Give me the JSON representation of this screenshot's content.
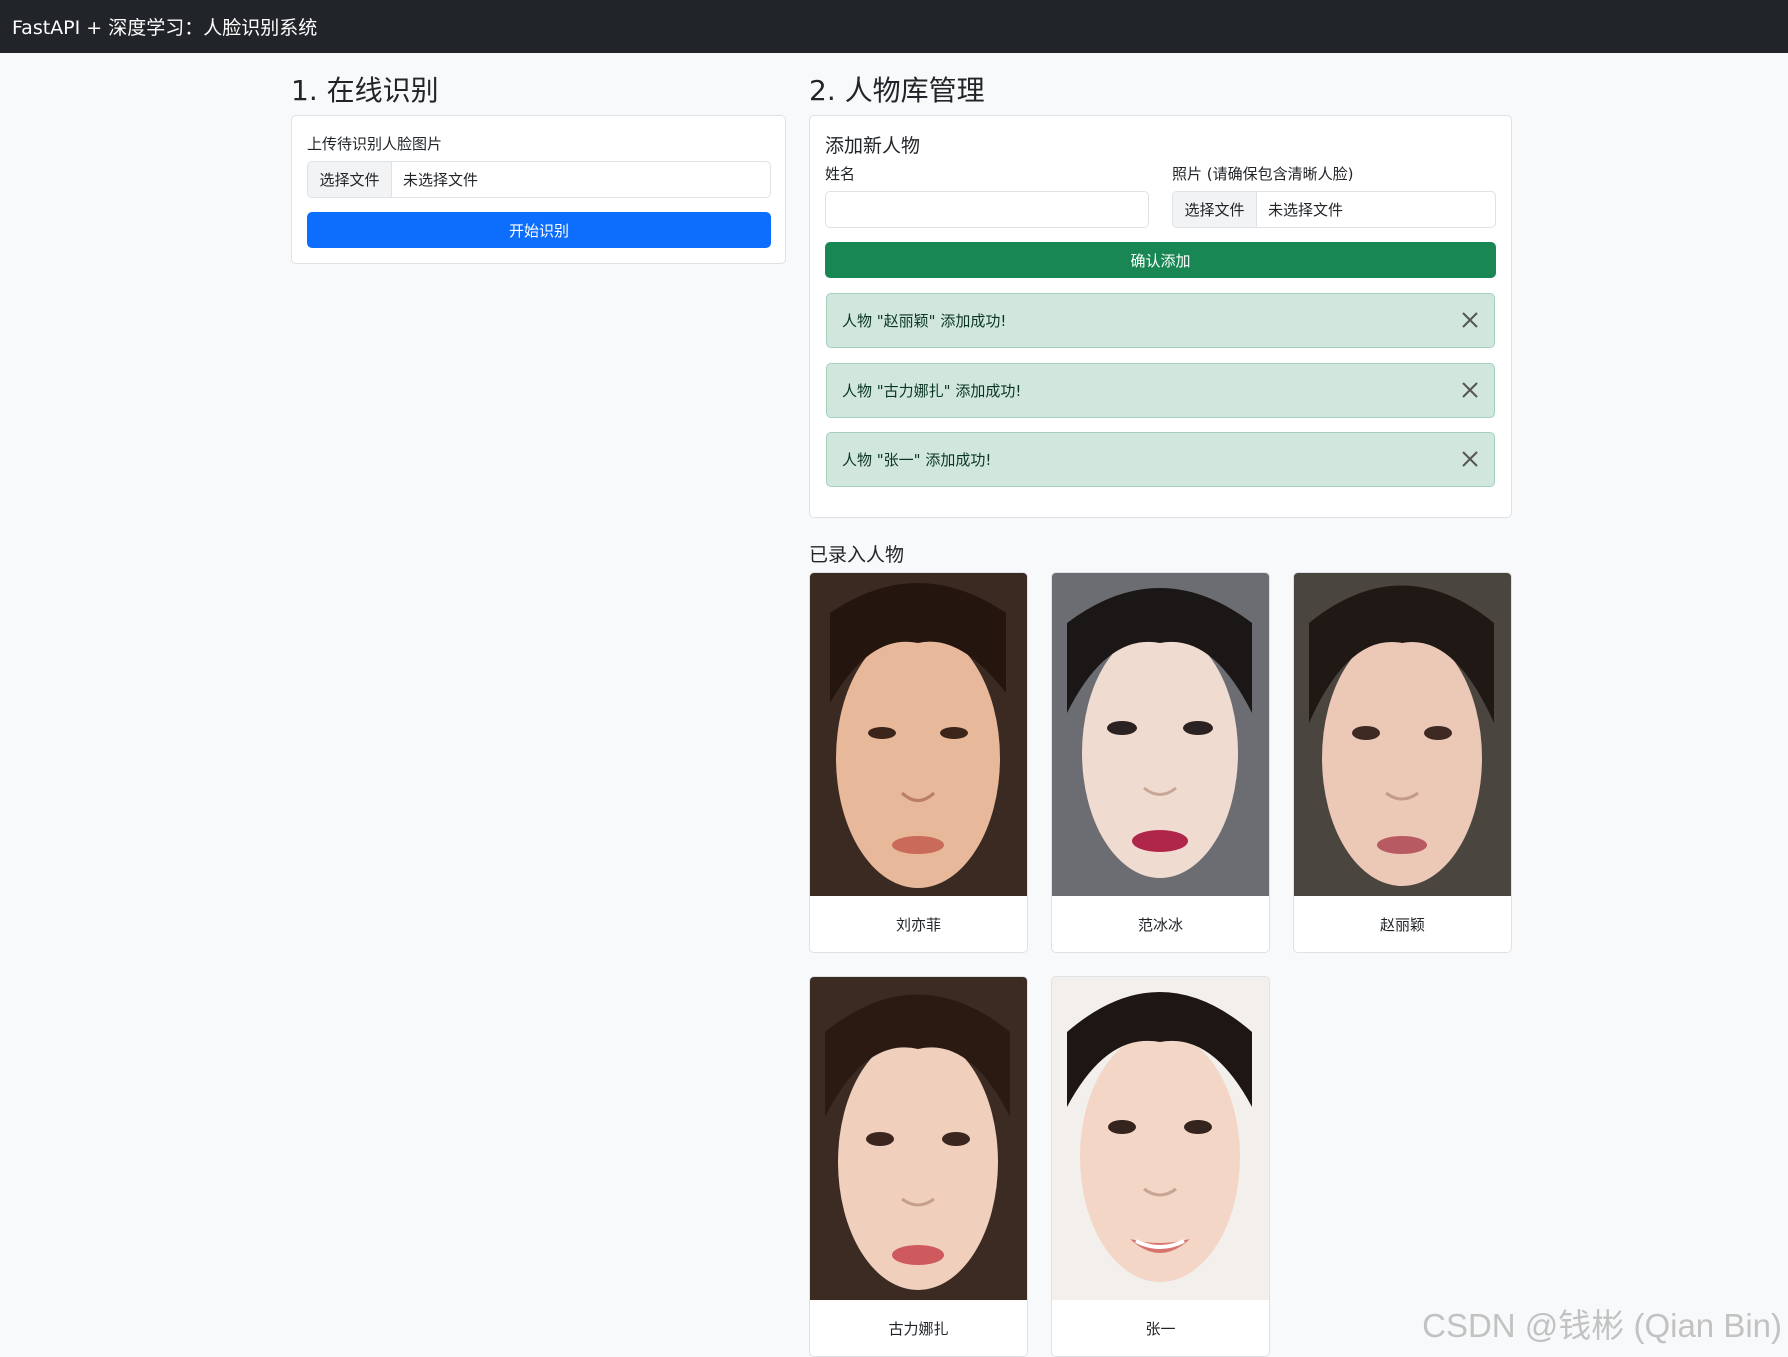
{
  "navbar": {
    "brand": "FastAPI + 深度学习：人脸识别系统"
  },
  "recognize": {
    "title": "1. 在线识别",
    "upload_label": "上传待识别人脸图片",
    "file_button": "选择文件",
    "file_status": "未选择文件",
    "submit": "开始识别"
  },
  "library": {
    "title": "2. 人物库管理",
    "add_title": "添加新人物",
    "name_label": "姓名",
    "name_value": "",
    "photo_label": "照片 (请确保包含清晰人脸)",
    "file_button": "选择文件",
    "file_status": "未选择文件",
    "submit": "确认添加",
    "alerts": [
      {
        "text": "人物 \"赵丽颖\" 添加成功!"
      },
      {
        "text": "人物 \"古力娜扎\" 添加成功!"
      },
      {
        "text": "人物 \"张一\" 添加成功!"
      }
    ],
    "enrolled_title": "已录入人物",
    "people": [
      {
        "name": "刘亦菲"
      },
      {
        "name": "范冰冰"
      },
      {
        "name": "赵丽颖"
      },
      {
        "name": "古力娜扎"
      },
      {
        "name": "张一"
      }
    ]
  },
  "watermark": "CSDN @钱彬 (Qian Bin)",
  "colors": {
    "primary": "#0d6efd",
    "success": "#198754",
    "navbar": "#212529",
    "alert_bg": "#d1e7dd"
  }
}
